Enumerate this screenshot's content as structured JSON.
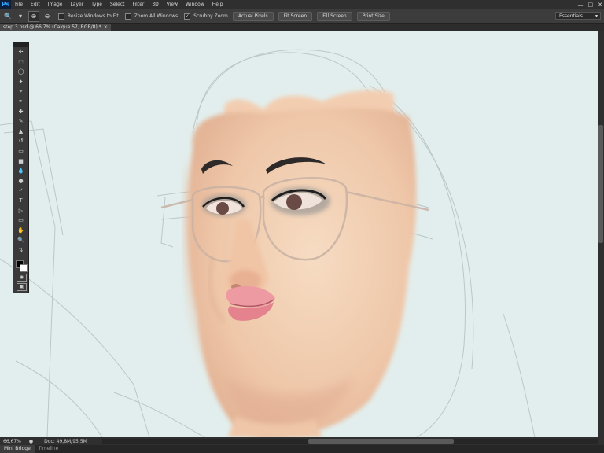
{
  "menubar": {
    "logo": "Ps",
    "items": [
      "File",
      "Edit",
      "Image",
      "Layer",
      "Type",
      "Select",
      "Filter",
      "3D",
      "View",
      "Window",
      "Help"
    ]
  },
  "options": {
    "resize_windows_label": "Resize Windows to Fit",
    "zoom_all_label": "Zoom All Windows",
    "scrubby_zoom_label": "Scrubby Zoom",
    "actual_pixels": "Actual Pixels",
    "fit_screen": "Fit Screen",
    "fill_screen": "Fill Screen",
    "print_size": "Print Size",
    "workspace": "Essentials"
  },
  "document": {
    "tab_title": "step 3.psd @ 66,7% (Calque 57, RGB/8) *"
  },
  "status": {
    "zoom": "66,67%",
    "doc_size": "Doc: 49,8M/95,5M"
  },
  "bottom_tabs": [
    "Mini Bridge",
    "Timeline"
  ],
  "colors": {
    "canvas_bg": "#e2eeed",
    "skin": "#f1c8a8",
    "lips": "#e88c95",
    "sketch": "#b9c4c6"
  }
}
